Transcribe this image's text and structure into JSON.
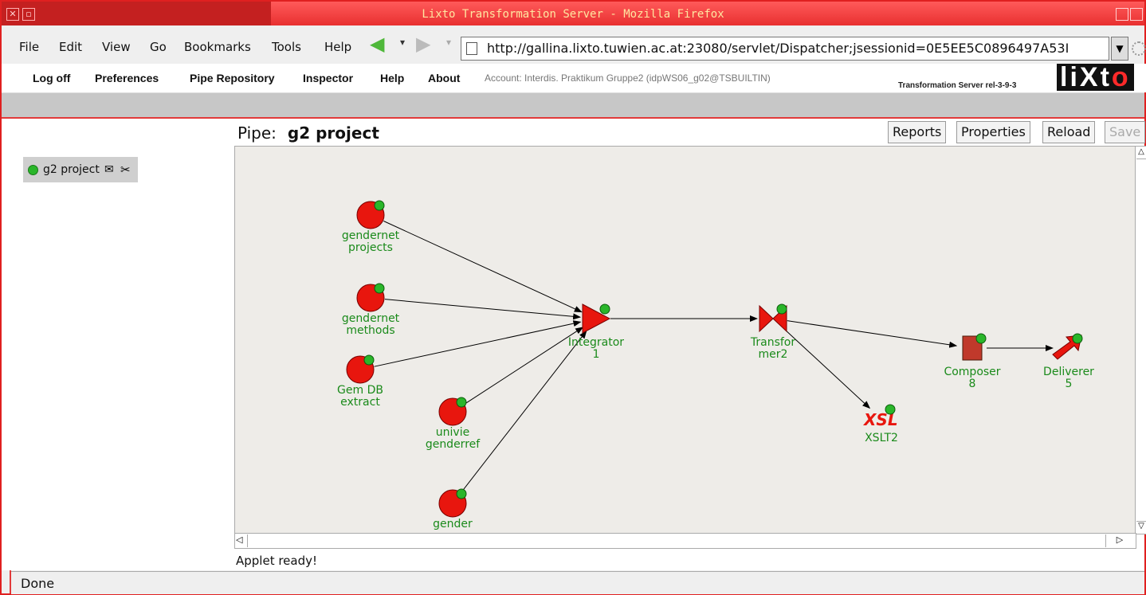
{
  "window": {
    "title": "Lixto Transformation Server - Mozilla Firefox"
  },
  "menubar": {
    "items": [
      "File",
      "Edit",
      "View",
      "Go",
      "Bookmarks",
      "Tools",
      "Help"
    ]
  },
  "url": {
    "value": "http://gallina.lixto.tuwien.ac.at:23080/servlet/Dispatcher;jsessionid=0E5EE5C0896497A53I"
  },
  "appnav": {
    "items": [
      "Log off",
      "Preferences",
      "Pipe Repository",
      "Inspector",
      "Help",
      "About"
    ],
    "account": "Account: Interdis. Praktikum Gruppe2 (idpWS06_g02@TSBUILTIN)",
    "release": "Transformation Server rel-3-9-3",
    "logo": "liXto"
  },
  "sidebar": {
    "pipe_name": "g2 project"
  },
  "pipe": {
    "label": "Pipe:",
    "name": "g2 project",
    "buttons": [
      "Reports",
      "Properties",
      "Reload",
      "Save"
    ]
  },
  "graph": {
    "nodes": [
      {
        "id": "gendernet-projects",
        "type": "source",
        "label1": "gendernet",
        "label2": "projects"
      },
      {
        "id": "gendernet-methods",
        "type": "source",
        "label1": "gendernet",
        "label2": "methods"
      },
      {
        "id": "gem-db-extract",
        "type": "source",
        "label1": "Gem DB",
        "label2": "extract"
      },
      {
        "id": "univie-genderref",
        "type": "source",
        "label1": "univie",
        "label2": "genderref"
      },
      {
        "id": "gender",
        "type": "source",
        "label1": "gender",
        "label2": ""
      },
      {
        "id": "integrator-1",
        "type": "integrator",
        "label1": "Integrator",
        "label2": "1"
      },
      {
        "id": "transformer-2",
        "type": "transformer",
        "label1": "Transfor",
        "label2": "mer2"
      },
      {
        "id": "xslt-2",
        "type": "xslt",
        "label1": "XSLT2",
        "label2": "",
        "glyph": "XSL"
      },
      {
        "id": "composer-8",
        "type": "composer",
        "label1": "Composer",
        "label2": "8"
      },
      {
        "id": "deliverer-5",
        "type": "deliverer",
        "label1": "Deliverer",
        "label2": "5"
      }
    ],
    "edges": [
      [
        "gendernet-projects",
        "integrator-1"
      ],
      [
        "gendernet-methods",
        "integrator-1"
      ],
      [
        "gem-db-extract",
        "integrator-1"
      ],
      [
        "univie-genderref",
        "integrator-1"
      ],
      [
        "gender",
        "integrator-1"
      ],
      [
        "integrator-1",
        "transformer-2"
      ],
      [
        "transformer-2",
        "composer-8"
      ],
      [
        "transformer-2",
        "xslt-2"
      ],
      [
        "composer-8",
        "deliverer-5"
      ]
    ]
  },
  "applet_status": "Applet ready!",
  "status": "Done",
  "colors": {
    "node_red": "#e8160e",
    "label_green": "#1a8a1a",
    "status_green": "#2ab62a",
    "frame_red": "#e02020"
  }
}
